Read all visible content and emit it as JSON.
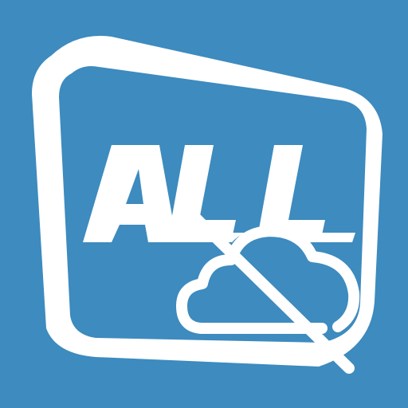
{
  "icon": {
    "logo_text": "ALL",
    "background_color": "#3d8bbf",
    "foreground_color": "#ffffff",
    "frame_icon": "tv-screen-frame-icon",
    "overlay_icon": "cloud-off-icon"
  }
}
